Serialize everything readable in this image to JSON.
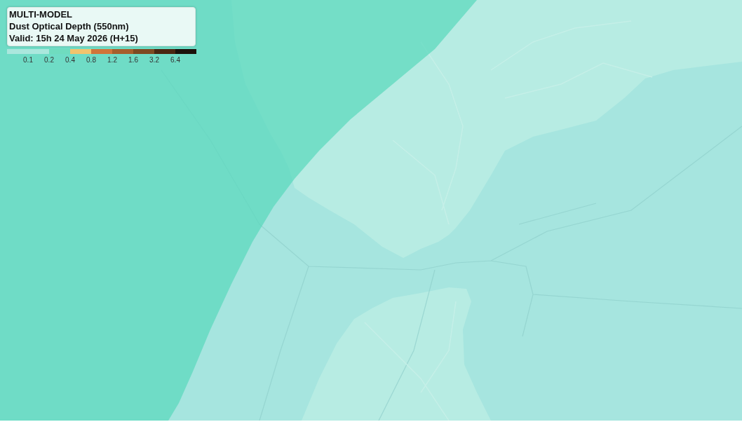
{
  "legend": {
    "title": "MULTI-MODEL",
    "subtitle": "Dust Optical Depth (550nm)",
    "valid": "Valid: 15h 24 May 2026 (H+15)",
    "color_scale": [
      {
        "color": "#aae7dd"
      },
      {
        "color": "#aae7dd"
      },
      {
        "color": "#6fdcbf"
      },
      {
        "color": "#f2c46e"
      },
      {
        "color": "#d0743a"
      },
      {
        "color": "#a65f2c"
      },
      {
        "color": "#7e4a22"
      },
      {
        "color": "#4a2712"
      },
      {
        "color": "#1c130c"
      }
    ],
    "ticks": [
      "0.1",
      "0.2",
      "0.4",
      "0.8",
      "1.2",
      "1.6",
      "3.2",
      "6.4"
    ]
  }
}
